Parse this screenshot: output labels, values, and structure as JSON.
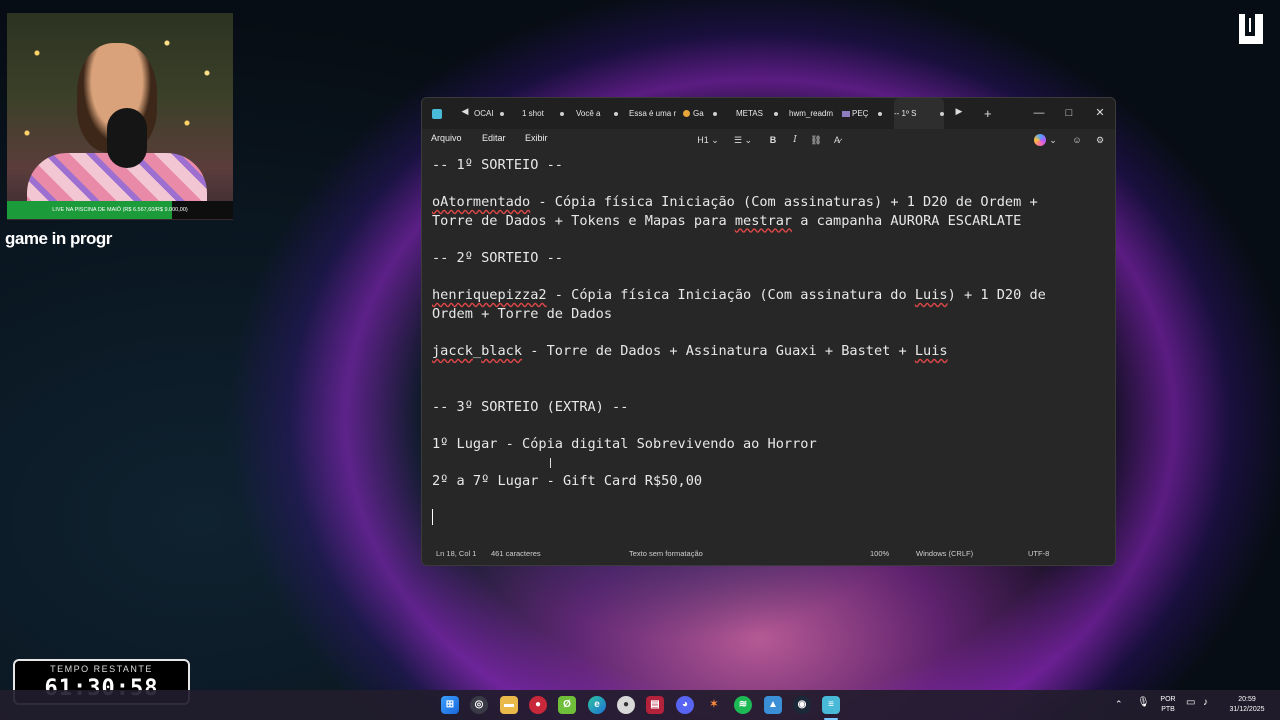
{
  "overlay": {
    "goal_text": "LIVE NA PISCINA DE MAIÔ (R$ 6.567,60/R$ 9.000,00)",
    "goal_progress": 0.73,
    "game_label": "game in progr",
    "timer_label": "TEMPO RESTANTE",
    "timer_value": "61:30:58"
  },
  "notepad": {
    "tabs": [
      {
        "label": "OCAI",
        "style": "plain"
      },
      {
        "label": "1 shot",
        "style": "plain"
      },
      {
        "label": "Você a",
        "style": "plain"
      },
      {
        "label": "Essa é uma r",
        "style": "plain"
      },
      {
        "label": "Ga",
        "style": "gold"
      },
      {
        "label": "METAS",
        "style": "plain"
      },
      {
        "label": "hwm_readm",
        "style": "plain"
      },
      {
        "label": "PEÇ",
        "style": "pec"
      },
      {
        "label": "-- 1º S",
        "style": "active"
      }
    ],
    "menu": {
      "file": "Arquivo",
      "edit": "Editar",
      "view": "Exibir"
    },
    "toolbar": {
      "heading": "H1",
      "bold": "B",
      "italic": "I"
    },
    "content": [
      "-- 1º SORTEIO --",
      "",
      "oAtormentado - Cópia física Iniciação (Com assinaturas) + 1 D20 de Ordem +",
      "Torre de Dados + Tokens e Mapas para mestrar a campanha AURORA ESCARLATE",
      "",
      "-- 2º SORTEIO --",
      "",
      "henriquepizza2 - Cópia física Iniciação (Com assinatura do Luis) + 1 D20 de",
      "Ordem + Torre de Dados",
      "",
      "jacck_black - Torre de Dados + Assinatura Guaxi + Bastet + Luis",
      "",
      "",
      "-- 3º SORTEIO (EXTRA) --",
      "",
      "1º Lugar - Cópia digital Sobrevivendo ao Horror",
      "",
      "2º a 7º Lugar - Gift Card R$50,00",
      "",
      ""
    ],
    "status": {
      "position": "Ln 18, Col 1",
      "chars": "461 caracteres",
      "format": "Texto sem formatação",
      "zoom": "100%",
      "line_ending": "Windows (CRLF)",
      "encoding": "UTF-8"
    }
  },
  "tray": {
    "lang1": "POR",
    "lang2": "PTB",
    "time": "20:59",
    "date": "31/12/2025"
  },
  "colors": {
    "accent": "#49b9d8",
    "goal_fill": "#1c9b3a",
    "taskbar": "#221c2c"
  }
}
